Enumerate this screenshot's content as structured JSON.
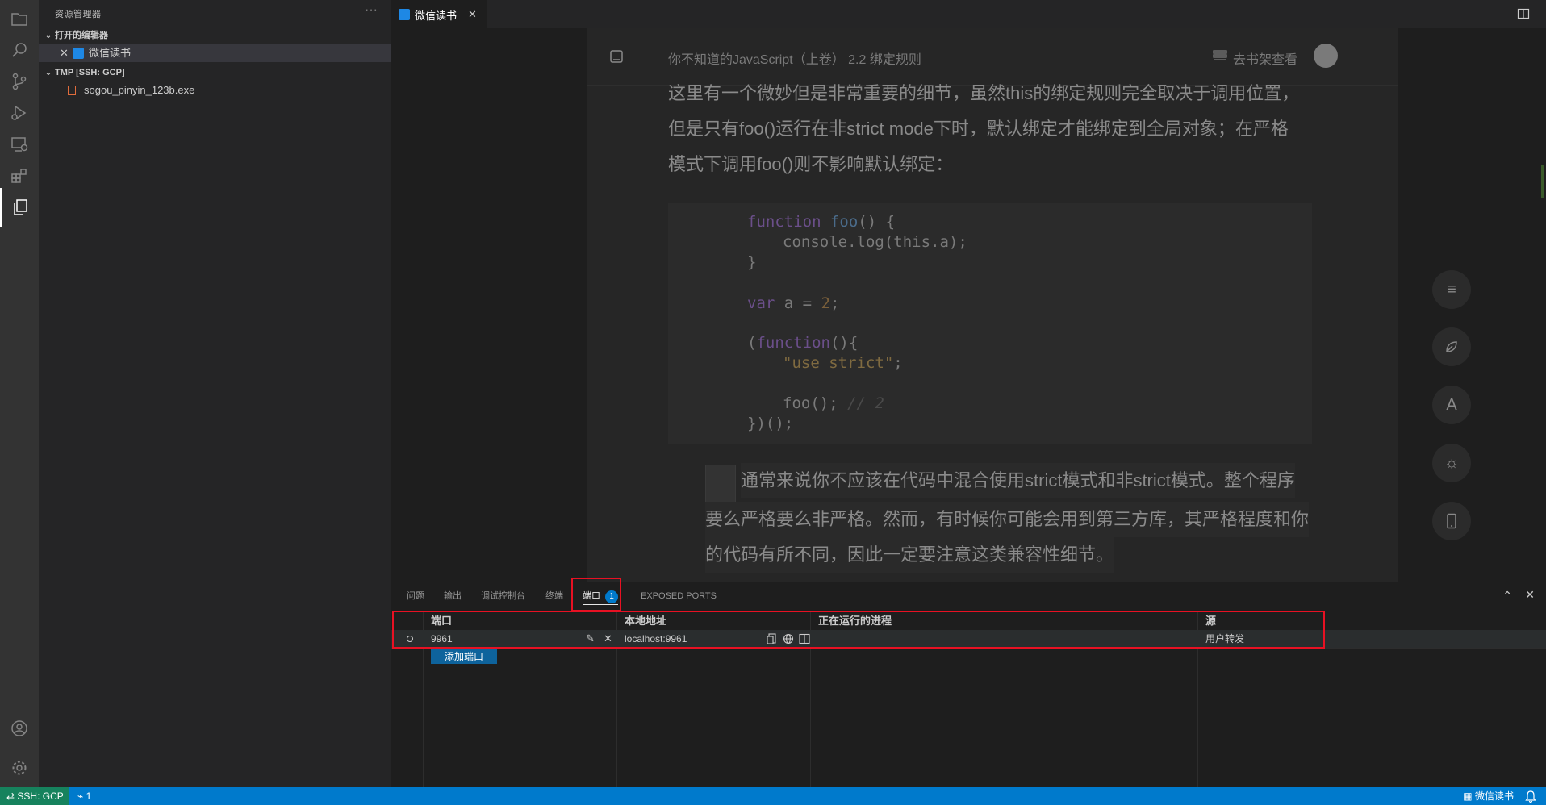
{
  "sidebar": {
    "title": "资源管理器",
    "more": "···",
    "open_editors_header": "打开的编辑器",
    "open_editor_item": "微信读书",
    "folder_header": "TMP [SSH: GCP]",
    "file_item": "sogou_pinyin_123b.exe"
  },
  "editor": {
    "tab_label": "微信读书",
    "reader": {
      "breadcrumb": "你不知道的JavaScript（上卷） 2.2 绑定规则",
      "shelf_link": "去书架查看",
      "paragraph1": [
        "这里有一个微妙但是非常重要的细节，虽然this的绑定规则完全取决于调用位置，",
        "但是只有foo()运行在非strict mode下时，默认绑定才能绑定到全局对象；在严格",
        "模式下调用foo()则不影响默认绑定："
      ],
      "code": {
        "l1_kw": "function",
        "l1_fn": "foo",
        "l1_rest": "() {",
        "l2": "console.log(this.a);",
        "l3": "}",
        "l4_kw": "var",
        "l4_mid": " a = ",
        "l4_num": "2",
        "l4_end": ";",
        "l5_a": "(",
        "l5_kw": "function",
        "l5_b": "(){",
        "l6_str": "\"use strict\"",
        "l6_end": ";",
        "l7": "foo();",
        "l7_cm": " // 2",
        "l8": "})();"
      },
      "note": [
        "通常来说你不应该在代码中混合使用strict模式和非strict模式。整个程序",
        "要么严格要么非严格。然而，有时候你可能会用到第三方库，其严格程度和你",
        "的代码有所不同，因此一定要注意这类兼容性细节。"
      ],
      "side_buttons": [
        "menu-icon",
        "leaf-icon",
        "font-icon",
        "brightness-icon",
        "phone-icon"
      ],
      "font_button_label": "A"
    }
  },
  "panel": {
    "tabs": [
      {
        "label": "问题"
      },
      {
        "label": "输出"
      },
      {
        "label": "调试控制台"
      },
      {
        "label": "终端"
      },
      {
        "label": "端口",
        "badge": "1"
      },
      {
        "label": "EXPOSED PORTS"
      }
    ],
    "columns": [
      "端口",
      "本地地址",
      "正在运行的进程",
      "源"
    ],
    "rows": [
      {
        "port": "9961",
        "local_address": "localhost:9961",
        "process": "",
        "origin": "用户转发"
      }
    ],
    "add_port_label": "添加端口"
  },
  "statusbar": {
    "remote": "SSH: GCP",
    "ports_count": "1",
    "right_item": "微信读书"
  },
  "colors": {
    "accent": "#007acc",
    "highlight_box": "#e81123",
    "remote_bg": "#16825d"
  }
}
